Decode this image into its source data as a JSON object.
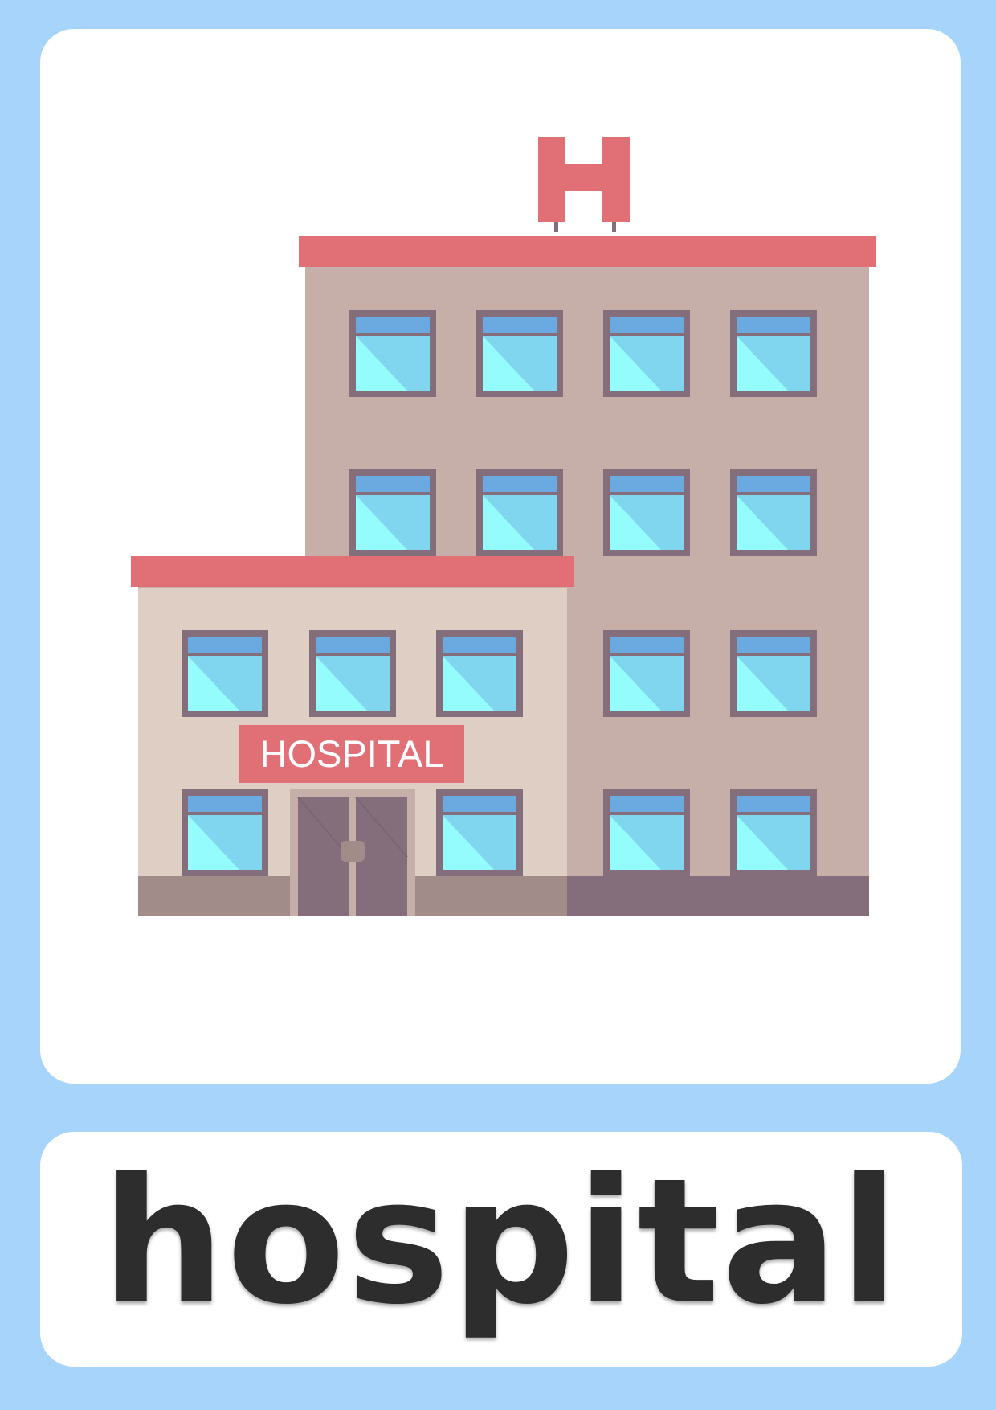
{
  "illustration": {
    "roof_sign_letter": "H",
    "facade_sign": "HOSPITAL"
  },
  "flashcard": {
    "word": "hospital"
  },
  "colors": {
    "background_frame": "#a6d4fb",
    "card": "#ffffff",
    "roof_and_sign": "#e07076",
    "tall_wall": "#c6afa8",
    "annex_wall": "#dfcec4",
    "window_frame": "#856e7b",
    "window_glass": "#80d6ee",
    "window_glass_light": "#95fcfe",
    "window_top": "#6aaae0",
    "word_text": "#2d2d2d"
  },
  "icons": [
    "hospital-building-icon",
    "h-sign-icon"
  ]
}
